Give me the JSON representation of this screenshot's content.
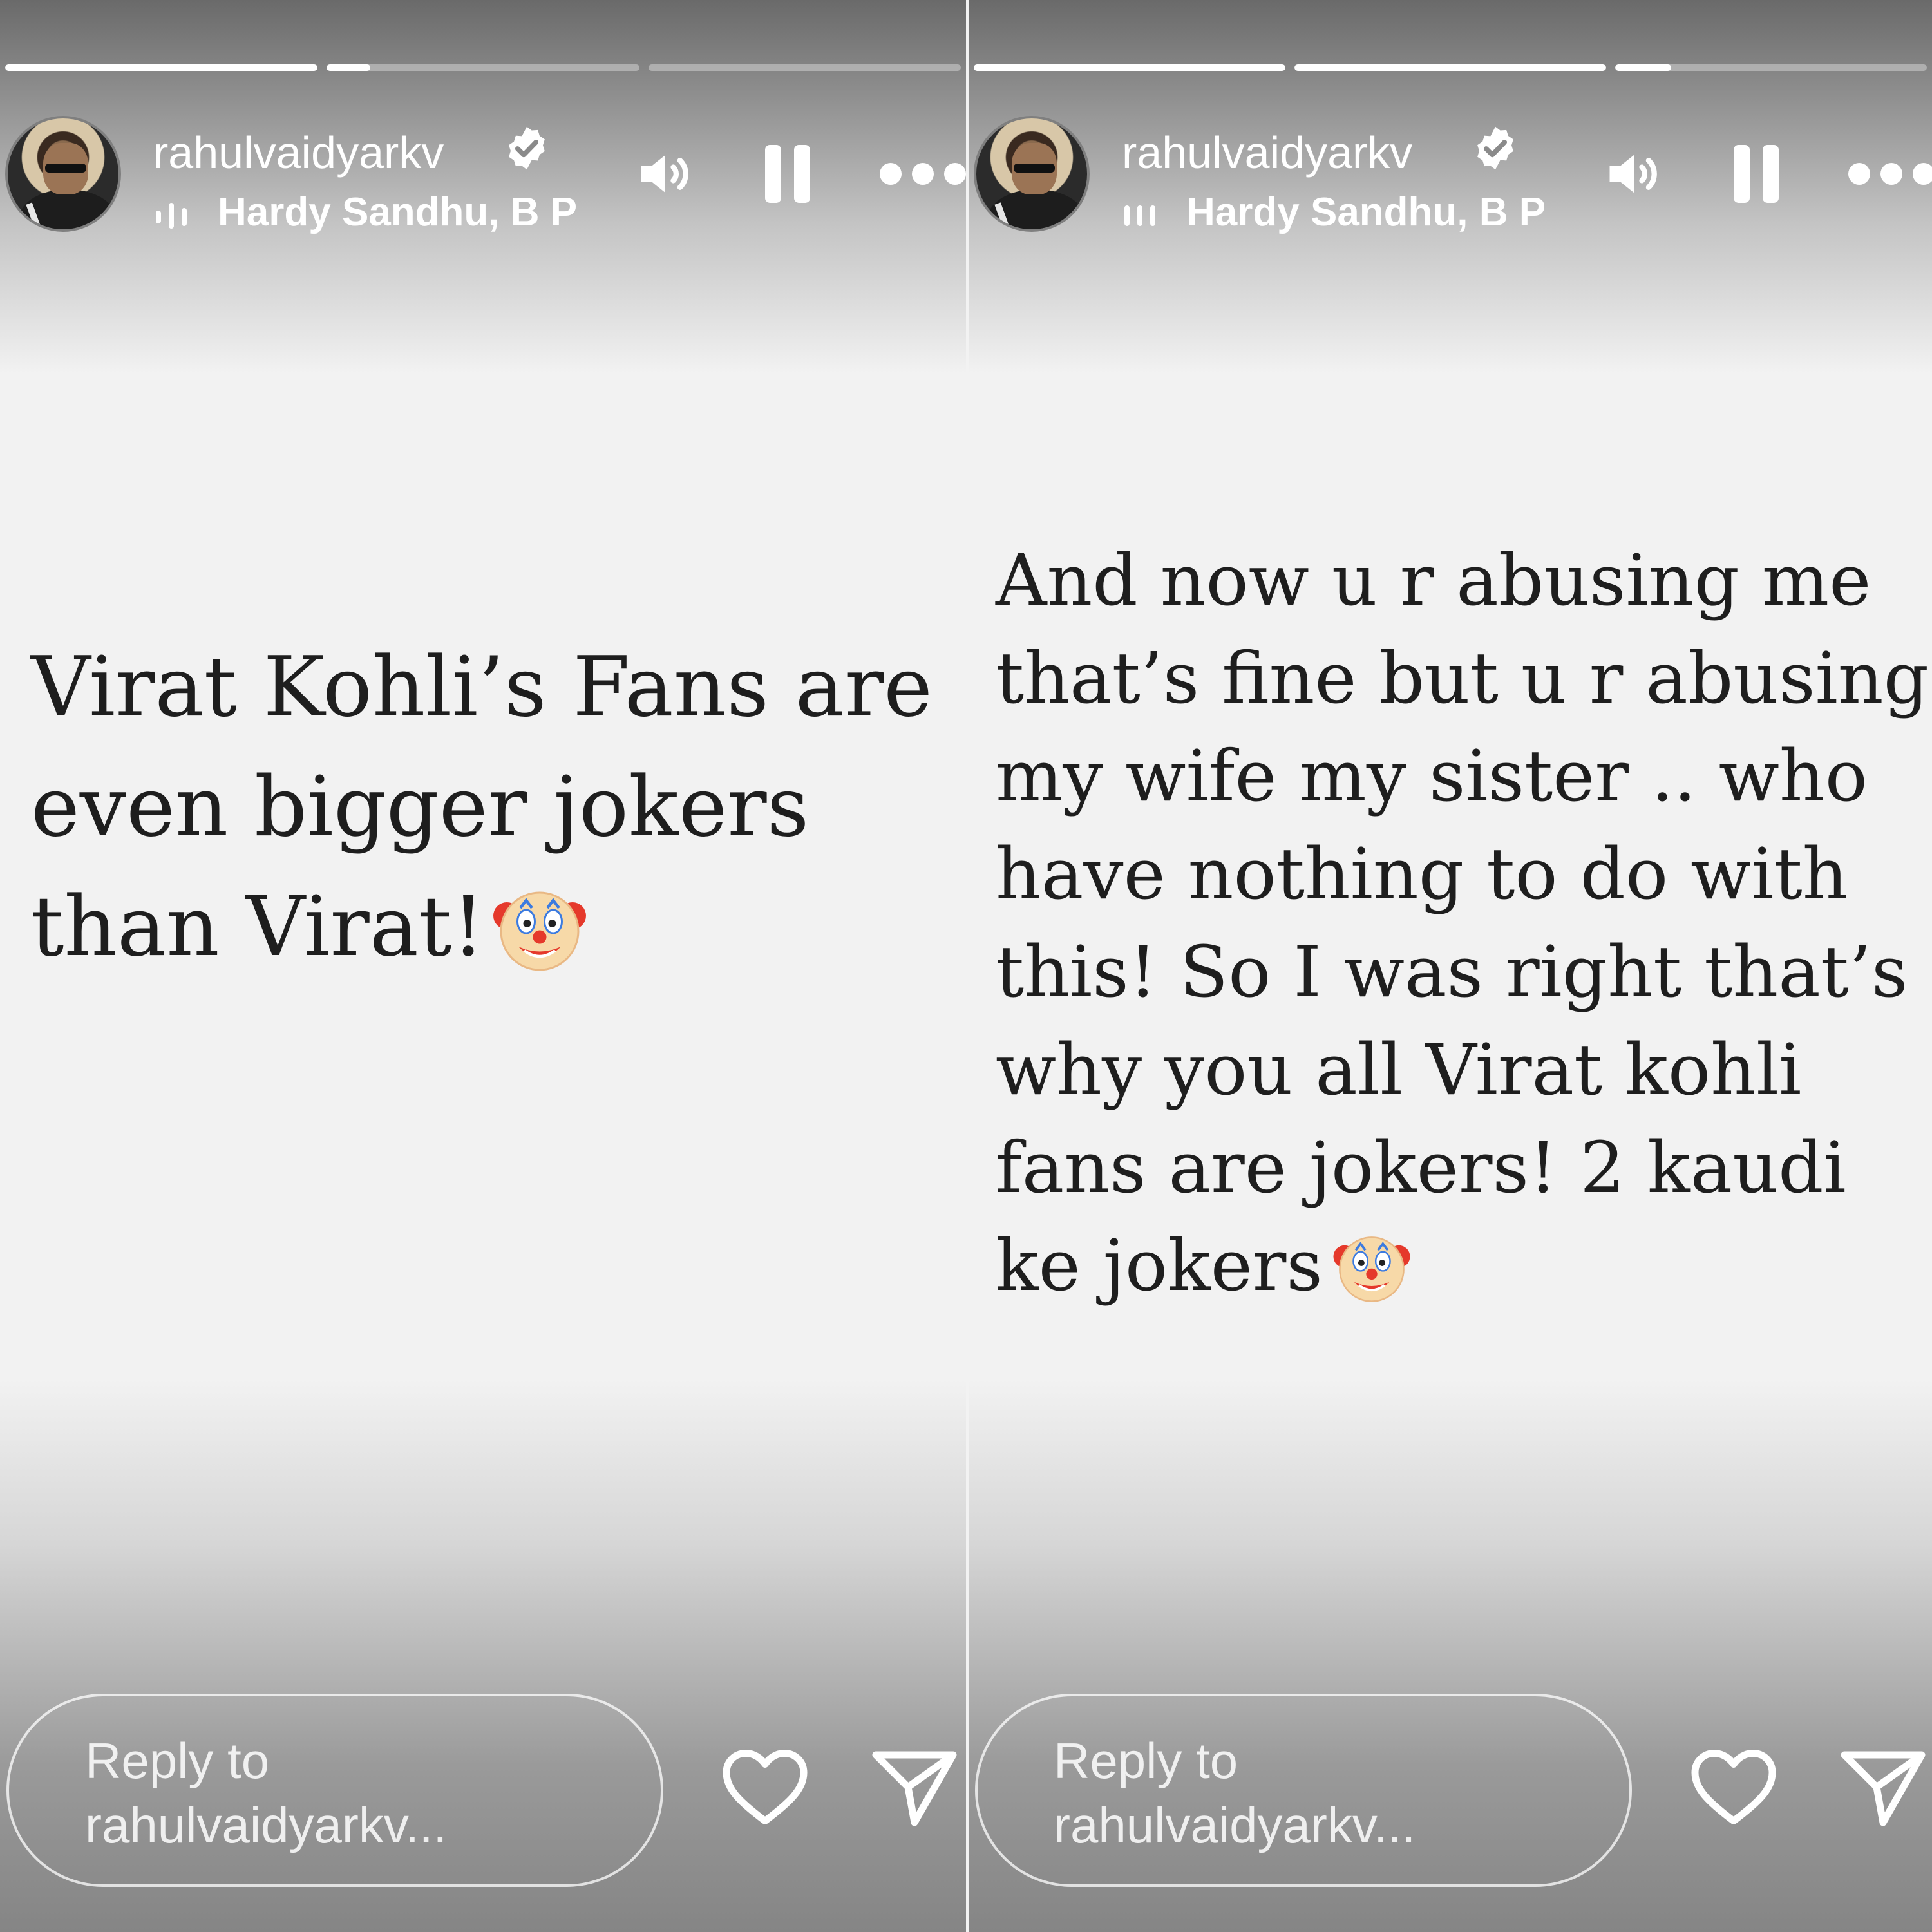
{
  "panels": [
    {
      "id": "left",
      "progress": [
        1.0,
        0.14,
        0.0
      ],
      "header": {
        "username": "rahulvaidyarkv",
        "music_text": "Hardy Sandhu, B P"
      },
      "story_text": "Virat Kohli’s Fans are even bigger jokers than Virat!",
      "reply": {
        "line1": "Reply to",
        "line2": "rahulvaidyarkv..."
      }
    },
    {
      "id": "right",
      "progress": [
        1.0,
        1.0,
        0.18
      ],
      "header": {
        "username": "rahulvaidyarkv",
        "music_text": "Hardy Sandhu, B P"
      },
      "story_text": "And now u r abusing me that’s fine but u r abusing my wife my sister .. who have nothing to do with this! So I was right that’s why you all Virat kohli fans are jokers! 2 kaudi ke jokers",
      "reply": {
        "line1": "Reply to",
        "line2": "rahulvaidyarkv..."
      }
    }
  ],
  "icons": {
    "verified": "verified-badge-icon",
    "music": "audio-bars-icon",
    "volume": "speaker-icon",
    "pause": "pause-icon",
    "more": "more-dots-icon",
    "emoji": "clown-face-emoji",
    "like": "heart-icon",
    "share": "send-icon"
  },
  "colors": {
    "story_background": "#f2f2f2",
    "text": "#1e1e1e",
    "overlay_ui": "#ffffff"
  }
}
